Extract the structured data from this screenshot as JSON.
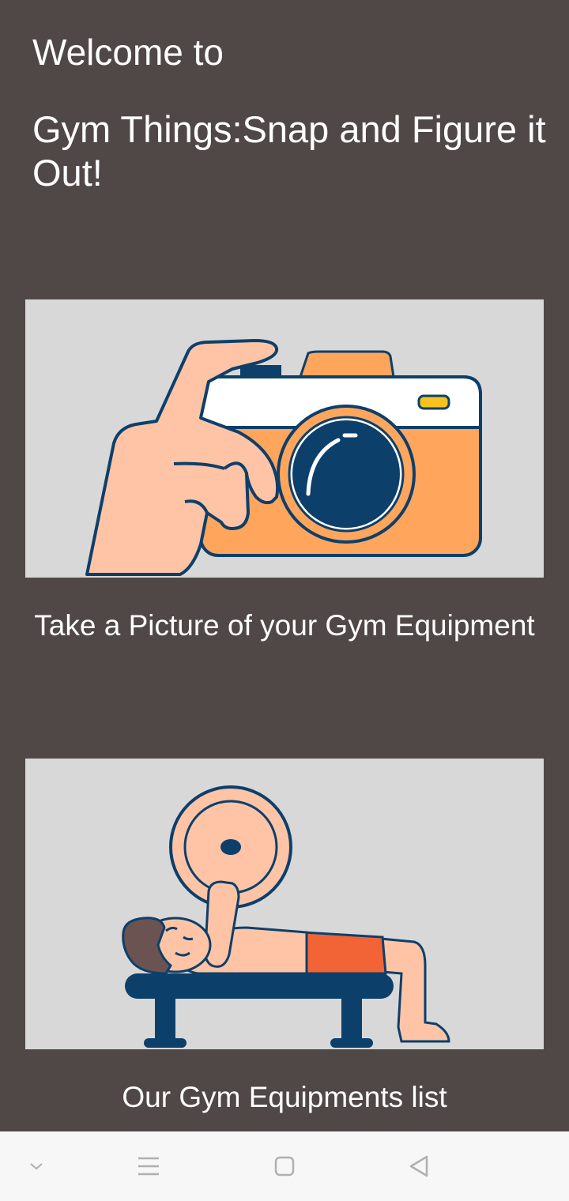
{
  "header": {
    "welcome": "Welcome to",
    "app_title": "Gym Things:Snap and Figure it Out!"
  },
  "cards": {
    "camera": {
      "caption": "Take a Picture of your Gym Equipment",
      "icon": "hand-camera-illustration"
    },
    "equipment_list": {
      "caption": "Our Gym Equipments list",
      "icon": "bench-press-illustration"
    }
  },
  "nav_bar": {
    "items": [
      "chevron-down-icon",
      "menu-icon",
      "home-square-icon",
      "back-triangle-icon"
    ]
  },
  "colors": {
    "background": "#504846",
    "card_background": "#d8d8d8",
    "accent_orange": "#ffa65c",
    "navy": "#0d3f6b",
    "skin": "#ffc4a6"
  }
}
